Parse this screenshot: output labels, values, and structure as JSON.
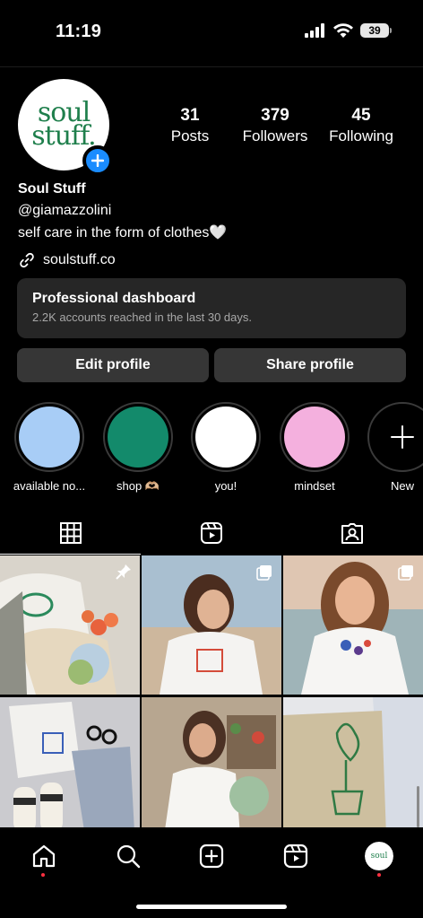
{
  "status_bar": {
    "time": "11:19",
    "battery": "39"
  },
  "profile": {
    "avatar_logo_line1": "soul",
    "avatar_logo_line2": "stuff.",
    "name": "Soul Stuff",
    "handle": "@giamazzolini",
    "bio": "self care in the form of clothes🤍",
    "link": "soulstuff.co"
  },
  "stats": [
    {
      "count": "31",
      "label": "Posts"
    },
    {
      "count": "379",
      "label": "Followers"
    },
    {
      "count": "45",
      "label": "Following"
    }
  ],
  "dashboard": {
    "title": "Professional dashboard",
    "subtitle": "2.2K accounts reached in the last 30 days."
  },
  "buttons": {
    "edit": "Edit profile",
    "share": "Share profile"
  },
  "highlights": [
    {
      "label": "available no...",
      "color": "#a8cdf6"
    },
    {
      "label": "shop 🫶🏼",
      "color": "#138a6b"
    },
    {
      "label": "you!",
      "color": "#ffffff"
    },
    {
      "label": "mindset",
      "color": "#f4b0de"
    },
    {
      "label": "New",
      "color": "#000000"
    }
  ],
  "tabs": [
    "grid-icon",
    "reels-icon",
    "tagged-icon"
  ],
  "grid_posts": [
    {
      "name": "post-self-care-tee-flowers",
      "color": "#d7d2c8",
      "pinned": true
    },
    {
      "name": "post-beach-smile",
      "color": "#c7a88c",
      "pinned": false
    },
    {
      "name": "post-beach-portrait",
      "color": "#d6b8a3",
      "pinned": false
    },
    {
      "name": "post-flatlay-outfit",
      "color": "#b8b8bc",
      "pinned": false
    },
    {
      "name": "post-greenhouse-tee",
      "color": "#a39583",
      "pinned": false
    },
    {
      "name": "post-plant-mom-tote",
      "color": "#cfc3a4",
      "pinned": false
    }
  ],
  "bottom_nav": [
    "home-icon",
    "search-icon",
    "create-icon",
    "reels-icon",
    "profile-avatar"
  ]
}
